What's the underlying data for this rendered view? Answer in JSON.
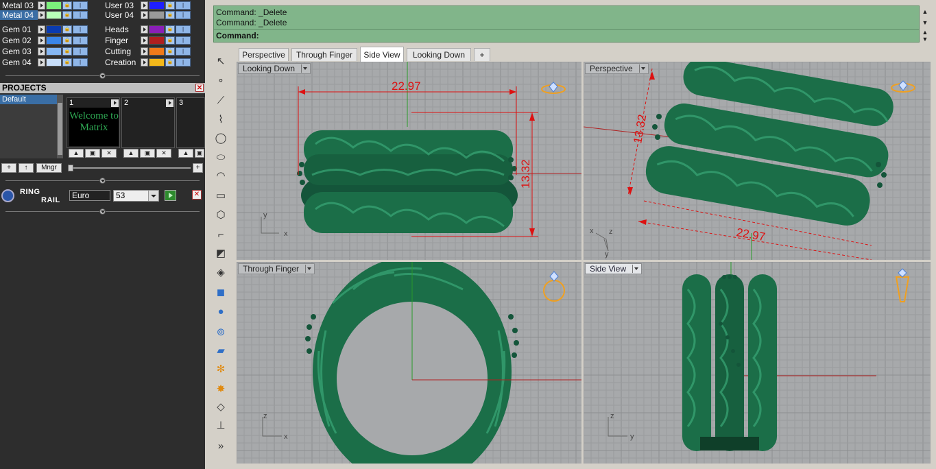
{
  "layers_left": [
    {
      "name": "Metal 03",
      "color": "#7cf07c",
      "selected": false
    },
    {
      "name": "Metal 04",
      "color": "#b8ffb8",
      "selected": true
    },
    {
      "name": "Gem 01",
      "color": "#0a3bb0",
      "selected": false
    },
    {
      "name": "Gem 02",
      "color": "#3b86e8",
      "selected": false
    },
    {
      "name": "Gem 03",
      "color": "#86b8f4",
      "selected": false
    },
    {
      "name": "Gem 04",
      "color": "#c7ddf9",
      "selected": false
    }
  ],
  "layers_right": [
    {
      "name": "User 03",
      "color": "#1f1fff"
    },
    {
      "name": "User 04",
      "color": "#9a9a9a"
    },
    {
      "name": "Heads",
      "color": "#8a1fb8"
    },
    {
      "name": "Finger",
      "color": "#b01f1f"
    },
    {
      "name": "Cutting",
      "color": "#f07a1a"
    },
    {
      "name": "Creation",
      "color": "#f4b81a"
    }
  ],
  "projects": {
    "title": "PROJECTS",
    "close": "✕",
    "list": [
      "Default"
    ],
    "slots": [
      {
        "num": "1",
        "thumb": "Welcome to Matrix"
      },
      {
        "num": "2"
      },
      {
        "num": "3"
      }
    ],
    "add": "+",
    "up": "↑",
    "manager": "Mngr",
    "plus": "+"
  },
  "ring_rail": {
    "title_a": "RING",
    "title_b": "RAIL",
    "unit": "Euro",
    "size": "53",
    "close": "✕"
  },
  "command": {
    "history": [
      "Command: _Delete",
      "Command: _Delete"
    ],
    "prompt": "Command:"
  },
  "tabs": [
    "Perspective",
    "Through Finger",
    "Side View",
    "Looking Down",
    "+"
  ],
  "active_tab": "Side View",
  "viewports": {
    "top_left": {
      "label": "Looking Down",
      "dim_width": "22.97",
      "dim_height": "13.32",
      "axis_a": "y",
      "axis_b": "x"
    },
    "top_right": {
      "label": "Perspective",
      "dim_width": "22.97",
      "dim_height": "13.32",
      "axis_a": "x",
      "axis_b": "z",
      "axis_c": "y"
    },
    "bottom_left": {
      "label": "Through Finger",
      "axis_a": "z",
      "axis_b": "x"
    },
    "bottom_right": {
      "label": "Side View",
      "axis_a": "z",
      "axis_b": "y"
    }
  },
  "colors": {
    "metal": "#1e6b45",
    "viewport_bg": "#a7a9ab",
    "grid": "#9a9c9e",
    "grid_major": "#8c8e90",
    "dimension": "#dd1111",
    "axis_x": "#b02020",
    "axis_y": "#2a9a2a",
    "command_bg": "#81b58a",
    "gem_icon": "#f0a020"
  },
  "toolbar_icons": [
    "select-arrow-icon",
    "point-icon",
    "polyline-icon",
    "curve-points-icon",
    "circle-icon",
    "ellipse-icon",
    "arc-icon",
    "rectangle-icon",
    "polygon-icon",
    "fillet-curve-icon",
    "surface-icon",
    "extrude-icon",
    "box-icon",
    "sphere-icon",
    "cylinder-icon",
    "plane-surface-icon",
    "gear-transform-icon",
    "explode-icon",
    "gem-tool-icon",
    "gauge-tool-icon",
    "more-icon"
  ]
}
